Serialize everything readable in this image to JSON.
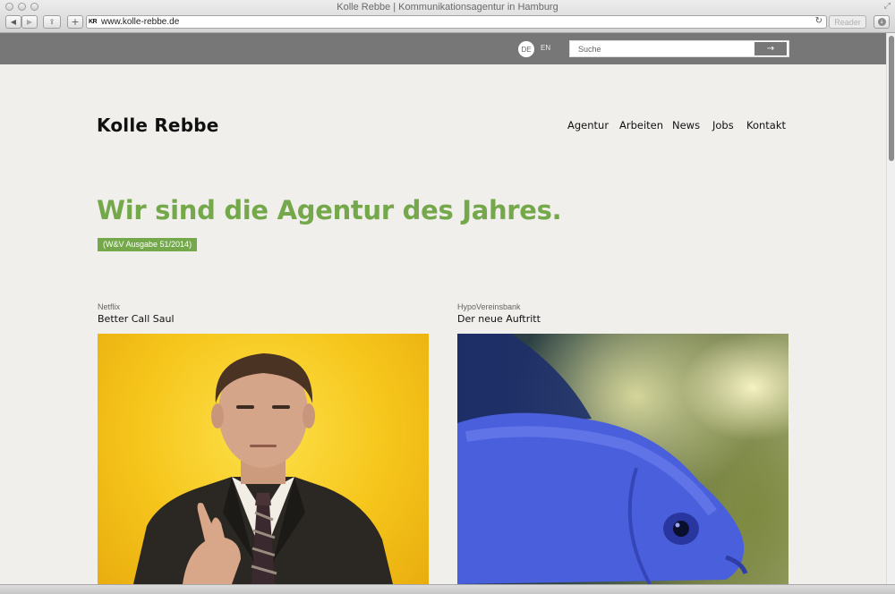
{
  "window": {
    "title": "Kolle Rebbe | Kommunikationsagentur in Hamburg",
    "url": "www.kolle-rebbe.de",
    "favicon_text": "KR",
    "reader_label": "Reader"
  },
  "topbar": {
    "languages": [
      "DE",
      "EN"
    ],
    "active_language": "DE",
    "search_placeholder": "Suche",
    "search_submit_glyph": "→"
  },
  "header": {
    "logo": "Kolle Rebbe",
    "nav": [
      "Agentur",
      "Arbeiten",
      "News",
      "Jobs",
      "Kontakt"
    ]
  },
  "hero": {
    "headline": "Wir sind die Agentur des Jahres.",
    "badge": "(W&V Ausgabe 51/2014)"
  },
  "projects": [
    {
      "client": "Netflix",
      "title": "Better Call Saul",
      "image": "man-pointing-portrait"
    },
    {
      "client": "HypoVereinsbank",
      "title": "Der neue Auftritt",
      "image": "blue-fish-closeup"
    }
  ],
  "colors": {
    "accent_green": "#74a84a",
    "topbar_grey": "#777777",
    "page_background": "#f0efec",
    "saul_yellow": "#f6c61c",
    "fish_blue": "#4a5fdc"
  }
}
